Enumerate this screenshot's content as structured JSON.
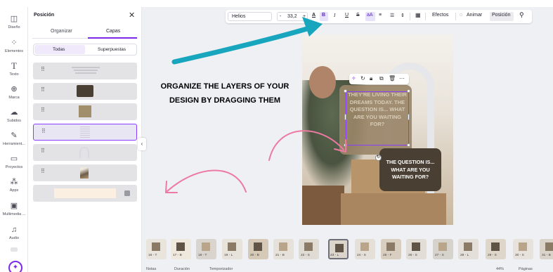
{
  "rail": [
    {
      "label": "Diseño",
      "icon": "layout-icon"
    },
    {
      "label": "Elementos",
      "icon": "elements-icon"
    },
    {
      "label": "Texto",
      "icon": "text-icon"
    },
    {
      "label": "Marca",
      "icon": "brand-icon"
    },
    {
      "label": "Subidos",
      "icon": "cloud-upload-icon"
    },
    {
      "label": "Herramient...",
      "icon": "tools-icon"
    },
    {
      "label": "Proyectos",
      "icon": "folder-icon"
    },
    {
      "label": "Apps",
      "icon": "apps-icon"
    },
    {
      "label": "Multimedia ...",
      "icon": "media-icon"
    },
    {
      "label": "Audio",
      "icon": "music-icon"
    }
  ],
  "panel": {
    "title": "Posición",
    "tabs": [
      "Organizar",
      "Capas"
    ],
    "active_tab": "Capas",
    "filters": [
      "Todas",
      "Superpuestas"
    ],
    "active_filter": "Todas",
    "layers": [
      {
        "kind": "text-lines"
      },
      {
        "kind": "dark-shape",
        "color": "#4a3f33"
      },
      {
        "kind": "tan-shape",
        "color": "#a18f6c"
      },
      {
        "kind": "text-block",
        "selected": true
      },
      {
        "kind": "arch-outline"
      },
      {
        "kind": "photo"
      },
      {
        "kind": "background",
        "color": "#fbefe1"
      }
    ]
  },
  "toolbar": {
    "font": "Helios",
    "minus": "-",
    "size": "33,2",
    "plus": "+",
    "text_color": "A",
    "bold": "B",
    "italic": "I",
    "underline": "U",
    "strike": "S",
    "case": "aA",
    "align": "≡",
    "list": "☰",
    "spacing": "⇕",
    "effects": "Efectos",
    "animate": "Animar",
    "position": "Posición"
  },
  "canvas": {
    "headline": "ORGANIZE THE LAYERS OF YOUR DESIGN BY DRAGGING THEM",
    "selected_text": "THEY'RE LIVING THEIR DREAMS TODAY. THE QUESTION IS... WHAT ARE YOU WAITING FOR?",
    "card_text": "THE QUESTION IS... WHAT ARE YOU WAITING FOR?",
    "colors": {
      "accent": "#8b3dff",
      "arrow_teal": "#17a6be",
      "arrow_pink": "#ec7aa3",
      "card": "#4a3f33"
    }
  },
  "pages": [
    {
      "label": "16 - T"
    },
    {
      "label": "17 - B"
    },
    {
      "label": "18 - T"
    },
    {
      "label": "19 - L"
    },
    {
      "label": "20 - B"
    },
    {
      "label": "21 - B"
    },
    {
      "label": "22 - S"
    },
    {
      "label": "23 - L",
      "selected": true
    },
    {
      "label": "24 - S"
    },
    {
      "label": "25 - F"
    },
    {
      "label": "26 - S"
    },
    {
      "label": "27 - S"
    },
    {
      "label": "28 - L"
    },
    {
      "label": "29 - S"
    },
    {
      "label": "30 - S"
    },
    {
      "label": "31 - B"
    }
  ],
  "footer": {
    "notes": "Notas",
    "duration": "Duración",
    "timer": "Temporizador",
    "zoom": "44%",
    "pages": "Páginas"
  }
}
